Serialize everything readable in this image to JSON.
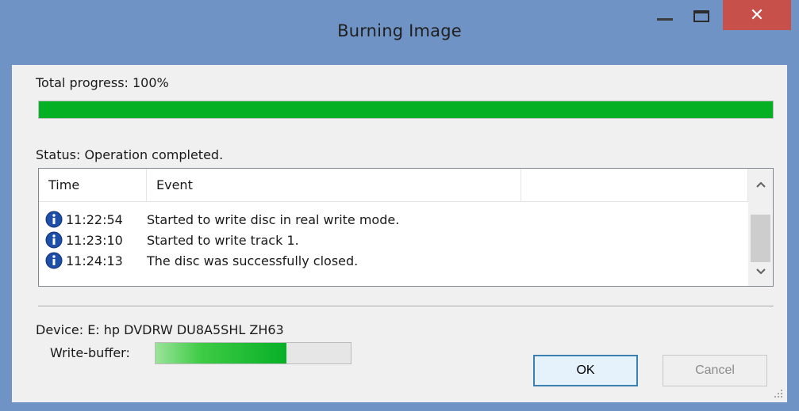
{
  "window": {
    "title": "Burning Image",
    "close_glyph": "✕",
    "colors": {
      "frame": "#6f93c4",
      "close": "#c7504a",
      "progress": "#06b025"
    }
  },
  "progress": {
    "label": "Total progress: 100%",
    "value_fraction": 1.0
  },
  "status": {
    "label": "Status: Operation completed."
  },
  "log": {
    "columns": [
      "Time",
      "Event",
      ""
    ],
    "rows": [
      {
        "icon": "info-icon",
        "time": "11:22:54",
        "event": "Started to write disc in real write mode."
      },
      {
        "icon": "info-icon",
        "time": "11:23:10",
        "event": "Started to write track 1."
      },
      {
        "icon": "info-icon",
        "time": "11:24:13",
        "event": "The disc was successfully closed."
      }
    ]
  },
  "device": {
    "label": "Device: E: hp DVDRW  DU8A5SHL ZH63",
    "write_buffer_label": "Write-buffer:",
    "write_buffer_fraction": 0.67
  },
  "buttons": {
    "ok": "OK",
    "cancel": "Cancel"
  }
}
